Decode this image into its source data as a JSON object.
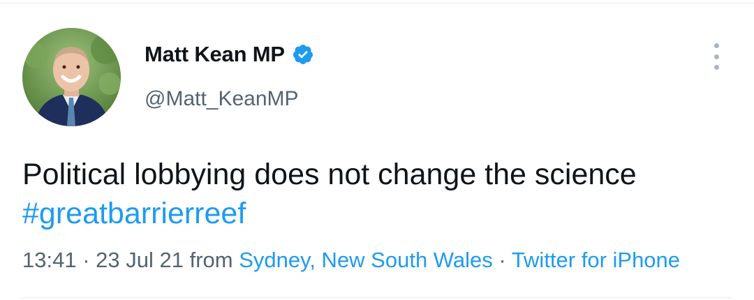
{
  "tweet": {
    "author": {
      "display_name": "Matt Kean MP",
      "handle": "@Matt_KeanMP",
      "verified": true,
      "avatar_icon": "profile-photo"
    },
    "text": "Political lobbying does not change the science",
    "hashtag": "#greatbarrierreef",
    "meta": {
      "time": "13:41",
      "separator_1": "·",
      "date": "23 Jul 21",
      "from_label": "from",
      "location": "Sydney, New South Wales",
      "separator_2": "·",
      "source": "Twitter for iPhone"
    },
    "menu_icon": "more-vertical-icon"
  },
  "colors": {
    "link": "#1d9bf0",
    "secondary_text": "#536471",
    "primary_text": "#0f1419",
    "divider": "#e6e9ec"
  }
}
